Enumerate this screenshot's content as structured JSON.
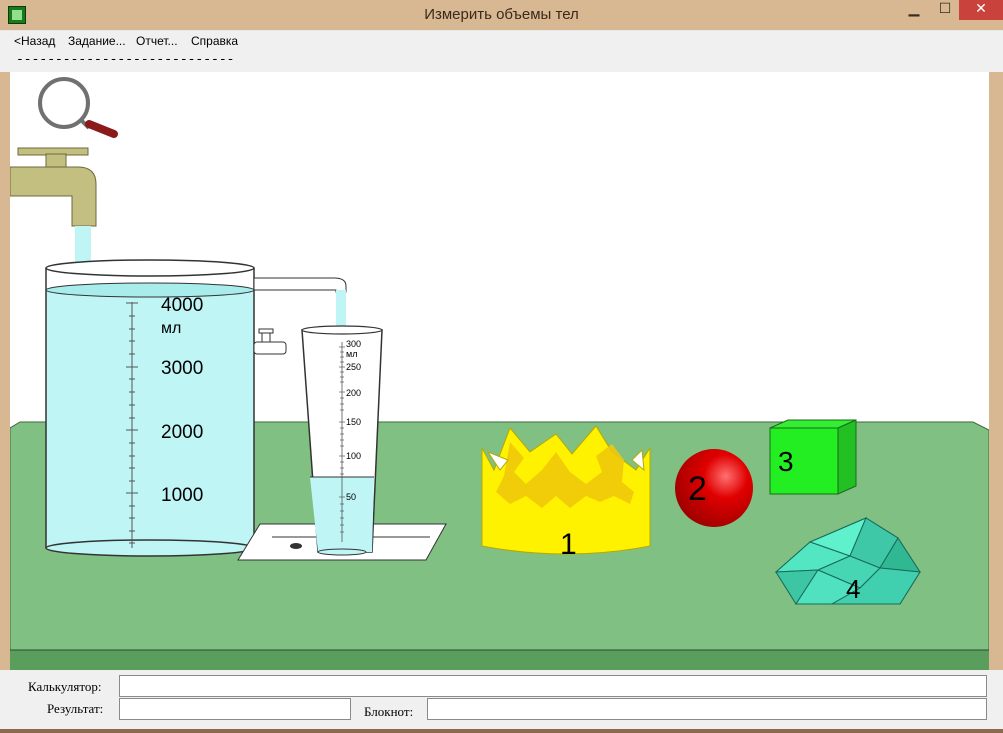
{
  "window": {
    "title": "Измерить объемы тел",
    "min": "▁",
    "max": "☐",
    "close": "✕"
  },
  "menu": {
    "items": [
      "<Назад",
      "Задание...",
      "Отчет...",
      "Справка"
    ]
  },
  "status": {
    "dashes": "----------------------------"
  },
  "scene": {
    "beaker": {
      "ticks": [
        "4000",
        "3000",
        "2000",
        "1000"
      ],
      "unit": "мл"
    },
    "cylinder": {
      "ticks": [
        "300",
        "250",
        "200",
        "150",
        "100",
        "50"
      ],
      "unit": "мл"
    },
    "objects": [
      "1",
      "2",
      "3",
      "4"
    ],
    "icons": [
      "magnifier-icon"
    ]
  },
  "bottom": {
    "calculator_label": "Калькулятор:",
    "calculator_value": "",
    "result_label": "Результат:",
    "result_value": "",
    "notepad_label": "Блокнот:",
    "notepad_value": ""
  }
}
